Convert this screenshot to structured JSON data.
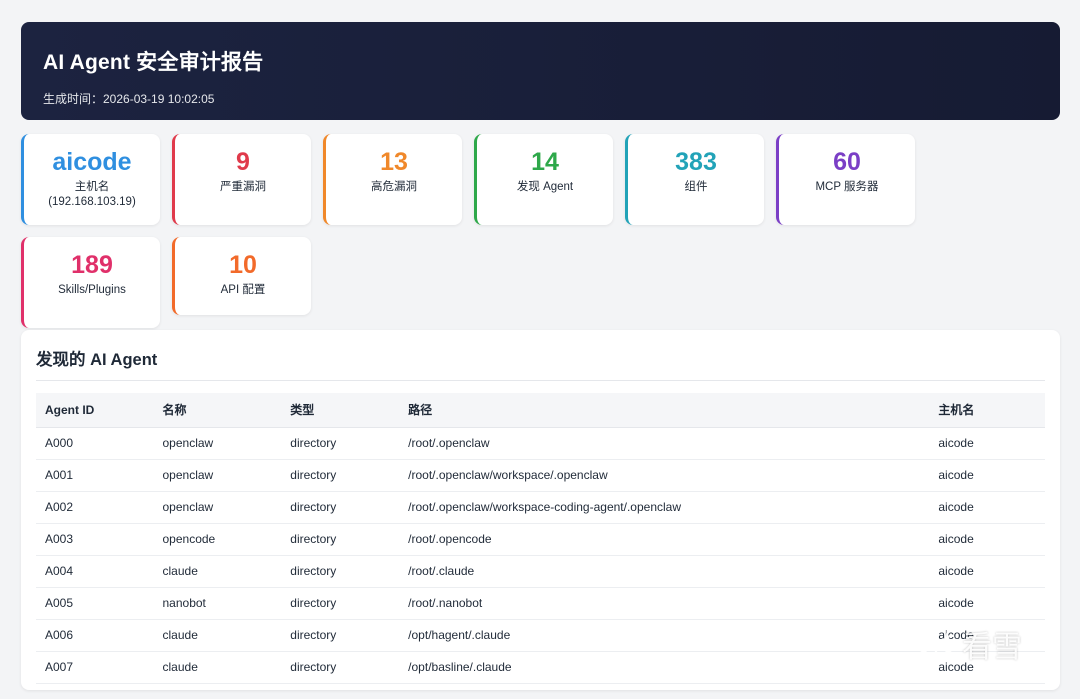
{
  "header": {
    "title": "AI Agent 安全审计报告",
    "generated": "生成时间：2026-03-19 10:02:05"
  },
  "cards": [
    {
      "value": "aicode",
      "label": "主机名\n(192.168.103.19)",
      "color": "#2f8fe0"
    },
    {
      "value": "9",
      "label": "严重漏洞",
      "color": "#e03a4b"
    },
    {
      "value": "13",
      "label": "高危漏洞",
      "color": "#f0882a"
    },
    {
      "value": "14",
      "label": "发现 Agent",
      "color": "#2ea84a"
    },
    {
      "value": "383",
      "label": "组件",
      "color": "#22a3b8"
    },
    {
      "value": "60",
      "label": "MCP 服务器",
      "color": "#7b3fc6"
    },
    {
      "value": "189",
      "label": "Skills/Plugins",
      "color": "#e0306a"
    },
    {
      "value": "10",
      "label": "API 配置",
      "color": "#f26a2a"
    }
  ],
  "agents": {
    "title": "发现的 AI Agent",
    "columns": [
      "Agent ID",
      "名称",
      "类型",
      "路径",
      "主机名"
    ],
    "rows": [
      [
        "A000",
        "openclaw",
        "directory",
        "/root/.openclaw",
        "aicode"
      ],
      [
        "A001",
        "openclaw",
        "directory",
        "/root/.openclaw/workspace/.openclaw",
        "aicode"
      ],
      [
        "A002",
        "openclaw",
        "directory",
        "/root/.openclaw/workspace-coding-agent/.openclaw",
        "aicode"
      ],
      [
        "A003",
        "opencode",
        "directory",
        "/root/.opencode",
        "aicode"
      ],
      [
        "A004",
        "claude",
        "directory",
        "/root/.claude",
        "aicode"
      ],
      [
        "A005",
        "nanobot",
        "directory",
        "/root/.nanobot",
        "aicode"
      ],
      [
        "A006",
        "claude",
        "directory",
        "/opt/hagent/.claude",
        "aicode"
      ],
      [
        "A007",
        "claude",
        "directory",
        "/opt/basline/.claude",
        "aicode"
      ]
    ]
  },
  "watermark": {
    "text": "看雪",
    "icon": "snowflake-icon"
  }
}
